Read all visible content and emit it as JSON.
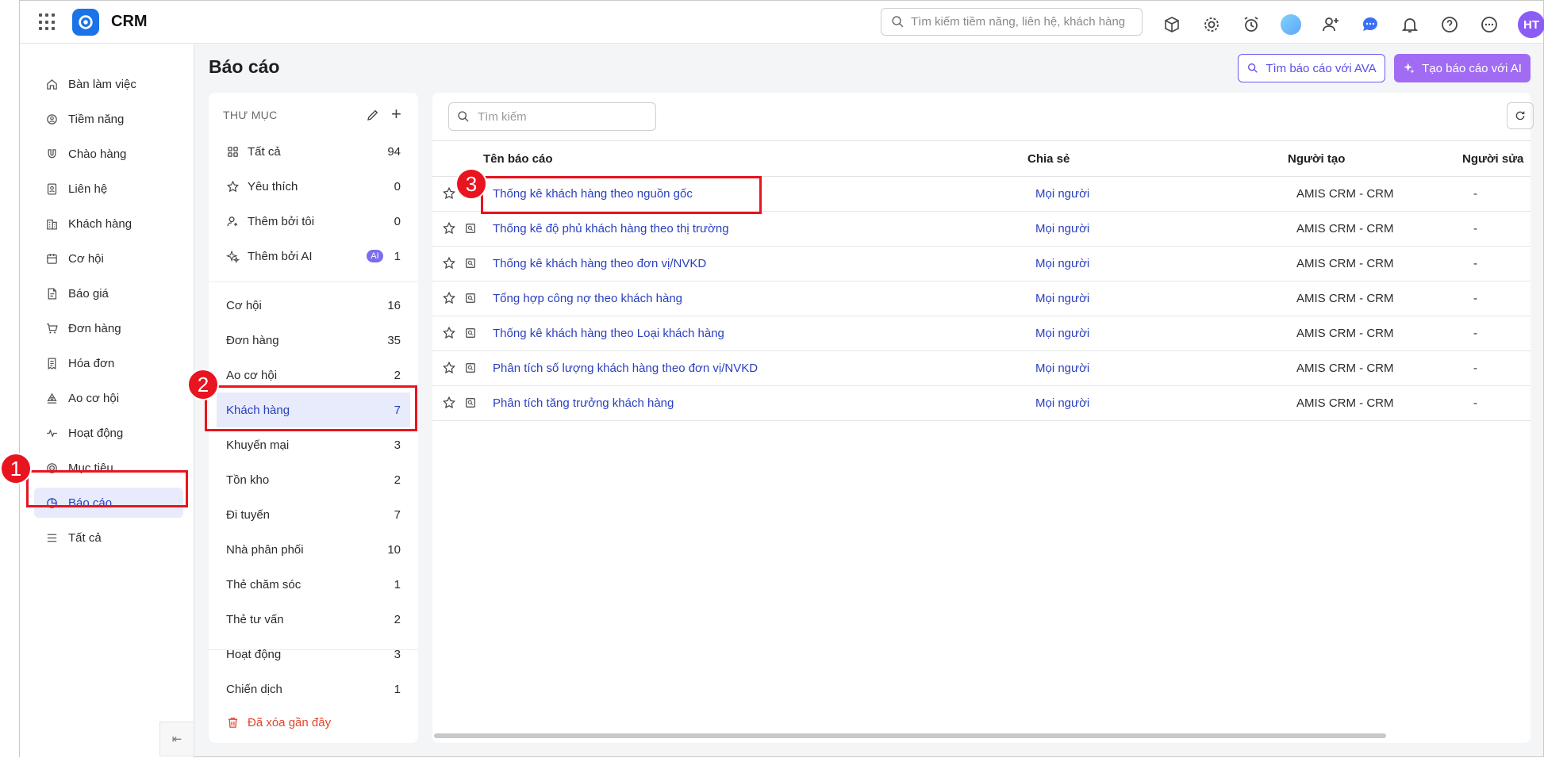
{
  "app": {
    "title": "CRM"
  },
  "topbar": {
    "search_placeholder": "Tìm kiếm tiềm năng, liên hệ, khách hàng",
    "avatar_initials": "HT"
  },
  "sidebar": {
    "items": [
      {
        "label": "Bàn làm việc",
        "icon": "home-icon"
      },
      {
        "label": "Tiềm năng",
        "icon": "target-user-icon"
      },
      {
        "label": "Chào hàng",
        "icon": "magnet-icon"
      },
      {
        "label": "Liên hệ",
        "icon": "contact-icon"
      },
      {
        "label": "Khách hàng",
        "icon": "building-icon"
      },
      {
        "label": "Cơ hội",
        "icon": "opportunity-icon"
      },
      {
        "label": "Báo giá",
        "icon": "quote-icon"
      },
      {
        "label": "Đơn hàng",
        "icon": "cart-icon"
      },
      {
        "label": "Hóa đơn",
        "icon": "invoice-icon"
      },
      {
        "label": "Ao cơ hội",
        "icon": "pond-icon"
      },
      {
        "label": "Hoạt động",
        "icon": "activity-icon"
      },
      {
        "label": "Mục tiêu",
        "icon": "goal-icon"
      },
      {
        "label": "Báo cáo",
        "icon": "report-icon",
        "active": true
      },
      {
        "label": "Tất cả",
        "icon": "menu-icon"
      }
    ]
  },
  "page": {
    "title": "Báo cáo",
    "btn_ava": "Tìm báo cáo với AVA",
    "btn_ai": "Tạo báo cáo với AI"
  },
  "folders": {
    "header": "THƯ MỤC",
    "top": [
      {
        "label": "Tất cả",
        "count": "94",
        "icon": "grid-icon"
      },
      {
        "label": "Yêu thích",
        "count": "0",
        "icon": "star-icon"
      },
      {
        "label": "Thêm bởi tôi",
        "count": "0",
        "icon": "user-add-icon"
      },
      {
        "label": "Thêm bởi AI",
        "count": "1",
        "icon": "sparkle-icon",
        "badge": "AI"
      }
    ],
    "list": [
      {
        "label": "Cơ hội",
        "count": "16"
      },
      {
        "label": "Đơn hàng",
        "count": "35"
      },
      {
        "label": "Ao cơ hội",
        "count": "2"
      },
      {
        "label": "Khách hàng",
        "count": "7",
        "active": true
      },
      {
        "label": "Khuyến mại",
        "count": "3"
      },
      {
        "label": "Tồn kho",
        "count": "2"
      },
      {
        "label": "Đi tuyến",
        "count": "7"
      },
      {
        "label": "Nhà phân phối",
        "count": "10"
      },
      {
        "label": "Thẻ chăm sóc",
        "count": "1"
      },
      {
        "label": "Thẻ tư vấn",
        "count": "2"
      },
      {
        "label": "Hoạt động",
        "count": "3"
      },
      {
        "label": "Chiến dịch",
        "count": "1"
      }
    ],
    "deleted": "Đã xóa gần đây"
  },
  "table": {
    "search_placeholder": "Tìm kiếm",
    "columns": {
      "name": "Tên báo cáo",
      "share": "Chia sẻ",
      "creator": "Người tạo",
      "editor": "Người sửa"
    },
    "rows": [
      {
        "name": "Thống kê khách hàng theo nguồn gốc",
        "share": "Mọi người",
        "creator": "AMIS CRM - CRM",
        "editor": "-"
      },
      {
        "name": "Thống kê độ phủ khách hàng theo thị trường",
        "share": "Mọi người",
        "creator": "AMIS CRM - CRM",
        "editor": "-"
      },
      {
        "name": "Thống kê khách hàng theo đơn vị/NVKD",
        "share": "Mọi người",
        "creator": "AMIS CRM - CRM",
        "editor": "-"
      },
      {
        "name": "Tổng hợp công nợ theo khách hàng",
        "share": "Mọi người",
        "creator": "AMIS CRM - CRM",
        "editor": "-"
      },
      {
        "name": "Thống kê khách hàng theo Loại khách hàng",
        "share": "Mọi người",
        "creator": "AMIS CRM - CRM",
        "editor": "-"
      },
      {
        "name": "Phân tích số lượng khách hàng theo đơn vị/NVKD",
        "share": "Mọi người",
        "creator": "AMIS CRM - CRM",
        "editor": "-"
      },
      {
        "name": "Phân tích tăng trưởng khách hàng",
        "share": "Mọi người",
        "creator": "AMIS CRM - CRM",
        "editor": "-"
      }
    ]
  },
  "annotations": [
    "1",
    "2",
    "3"
  ],
  "colors": {
    "accent": "#2a3fbf",
    "highlight": "#e8141f",
    "ai_purple": "#a16bf4"
  }
}
